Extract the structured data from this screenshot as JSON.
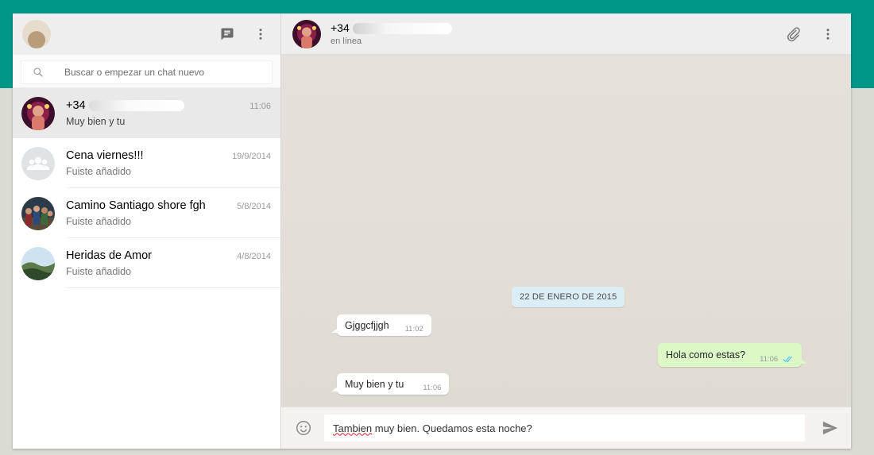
{
  "sidebar": {
    "search_placeholder": "Buscar o empezar un chat nuevo",
    "chats": [
      {
        "name": "+34",
        "time": "11:06",
        "preview": "Muy bien y tu",
        "active": true
      },
      {
        "name": "Cena viernes!!!",
        "time": "19/9/2014",
        "preview": "Fuiste añadido"
      },
      {
        "name": "Camino Santiago shore fgh",
        "time": "5/8/2014",
        "preview": "Fuiste añadido"
      },
      {
        "name": "Heridas de Amor",
        "time": "4/8/2014",
        "preview": "Fuiste añadido"
      }
    ]
  },
  "conversation": {
    "contact_name": "+34",
    "status": "en línea",
    "date_divider": "22 DE ENERO DE 2015",
    "messages": [
      {
        "direction": "in",
        "text": "Gjggcfjjgh",
        "time": "11:02"
      },
      {
        "direction": "out",
        "text": "Hola como estas?",
        "time": "11:06",
        "read": true
      },
      {
        "direction": "in",
        "text": "Muy bien y tu",
        "time": "11:06"
      }
    ],
    "compose": {
      "misspelled_word": "Tambien",
      "rest_text": " muy bien. Quedamos esta noche?"
    }
  },
  "icons": {
    "new_chat": "chat-bubble-icon",
    "menu": "more-vert-icon",
    "search": "search-icon",
    "attach": "paperclip-icon",
    "emoji": "smiley-icon",
    "send": "send-arrow-icon"
  },
  "colors": {
    "brand_band": "#009688",
    "outgoing_bubble": "#dcf8c6",
    "date_chip": "#dcedf6",
    "read_ticks": "#4fc3f7"
  }
}
